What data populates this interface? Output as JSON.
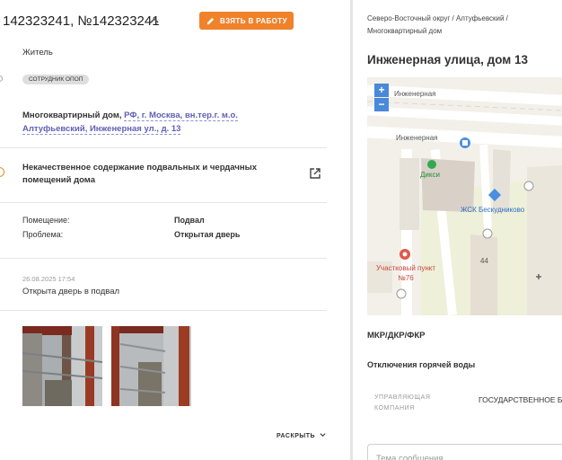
{
  "ticket": {
    "title": "142323241, №142323241",
    "action_label": "ВЗЯТЬ В РАБОТУ",
    "author_role": "Житель",
    "badge": "СОТРУДНИК ОПОП",
    "address_type": "Многоквартирный дом, ",
    "address_link": "РФ, г. Москва, вн.тер.г. м.о. Алтуфьевский, Инженерная ул., д. 13",
    "issue": "Некачественное содержание подвальных и чердачных помещений дома",
    "details": [
      {
        "key": "Помещение:",
        "value": "Подвал"
      },
      {
        "key": "Проблема:",
        "value": "Открытая дверь"
      }
    ],
    "comment_timestamp": "26.08.2025 17:54",
    "comment_text": "Открыта дверь в подвал",
    "expand_label": "РАСКРЫТЬ",
    "accent_color": "#f0822b",
    "link_color": "#5f5fb8"
  },
  "building": {
    "breadcrumb": "Северо-Восточный округ / Алтуфьевский / Многоквартирный дом",
    "title": "Инженерная улица, дом 13",
    "map": {
      "street_1": "Инженерная",
      "street_2": "Инженерная",
      "poi_shop": "Дикси",
      "poi_hoa": "ЖСК Бескудниково",
      "poi_police": "Участковый пункт №76",
      "house_number": "44",
      "zoom_in": "+",
      "zoom_out": "−"
    },
    "section_repairs": "МКР/ДКР/ФКР",
    "section_hot_water": "Отключения горячей воды",
    "management_label": "УПРАВЛЯЮЩАЯ КОМПАНИЯ",
    "management_value": "ГОСУДАРСТВЕННОЕ Б «ЖИЛИЩНИК АЛТУФ",
    "message_placeholder": "Тема сообщения"
  }
}
